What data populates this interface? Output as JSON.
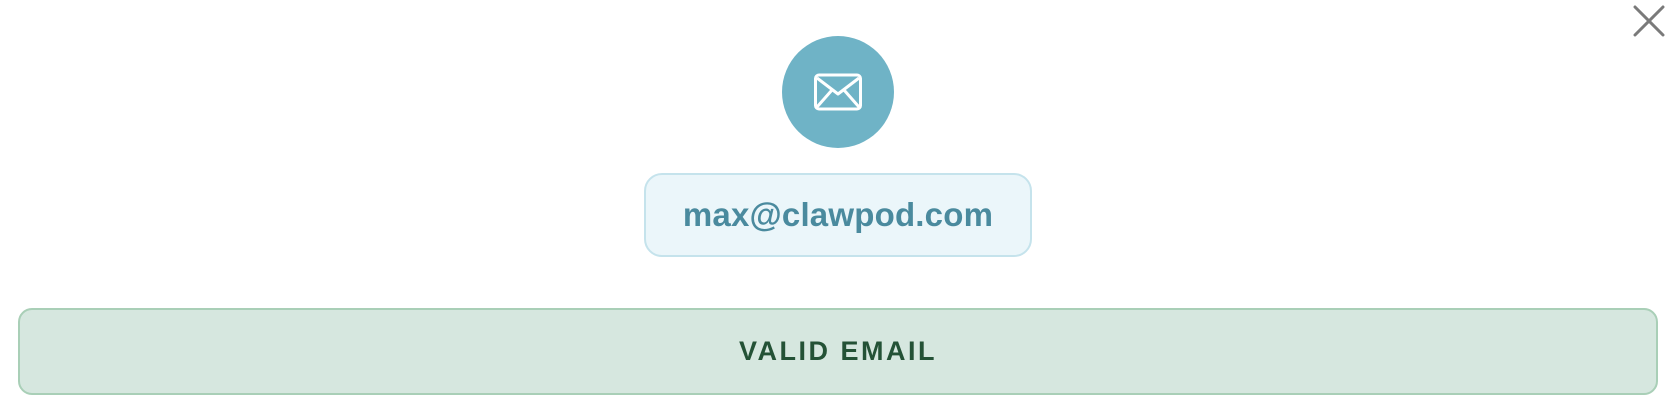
{
  "dialog": {
    "close_icon": "close-icon",
    "header_icon": "envelope-icon",
    "header_icon_bg": "#6fb3c6",
    "email": "max@clawpod.com",
    "status_label": "VALID EMAIL",
    "status_color": "#245236",
    "status_bg": "#d6e7df"
  }
}
